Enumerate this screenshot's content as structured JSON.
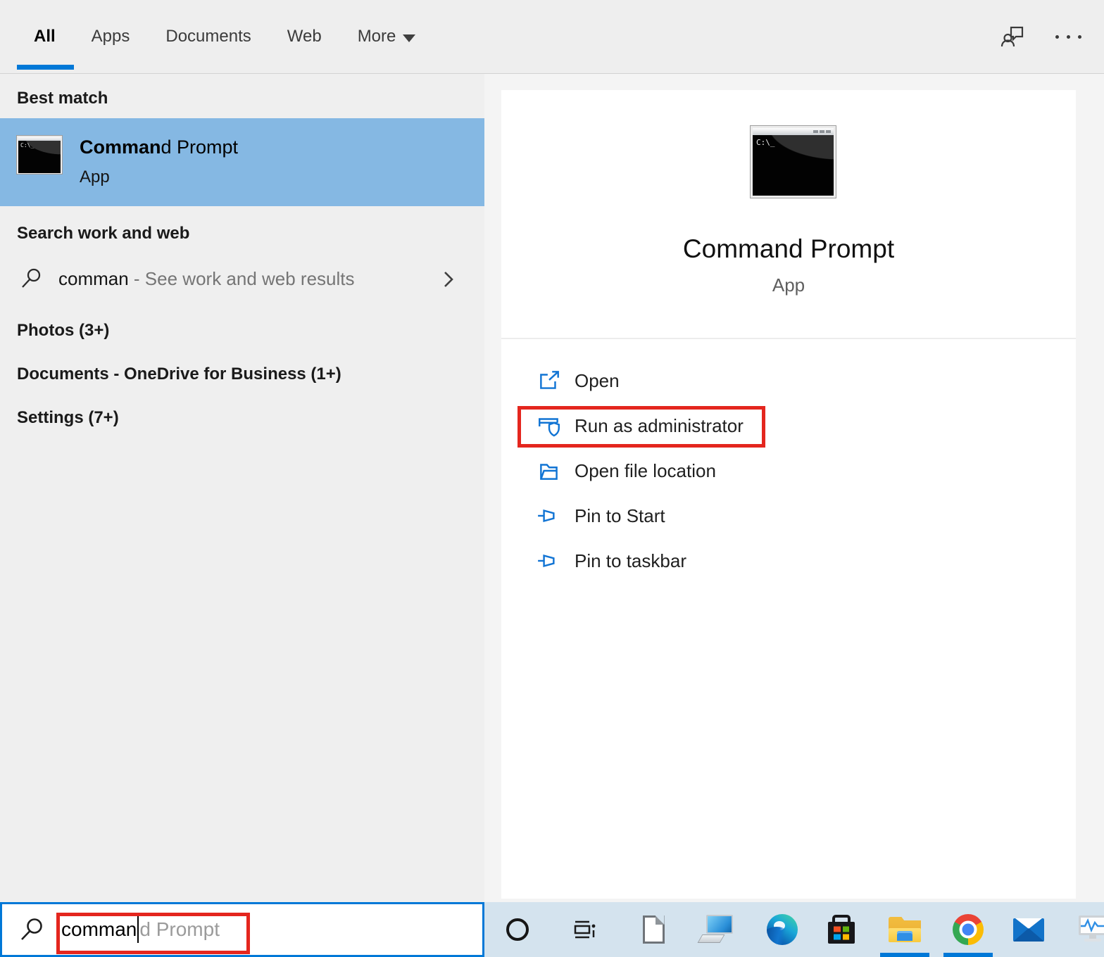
{
  "header": {
    "tabs": [
      {
        "label": "All",
        "active": true
      },
      {
        "label": "Apps",
        "active": false
      },
      {
        "label": "Documents",
        "active": false
      },
      {
        "label": "Web",
        "active": false
      },
      {
        "label": "More",
        "active": false,
        "dropdown": true
      }
    ]
  },
  "left_panel": {
    "best_match_label": "Best match",
    "best_match_item": {
      "title_match": "Comman",
      "title_rest": "d Prompt",
      "type": "App"
    },
    "search_web_label": "Search work and web",
    "web_row": {
      "query": "comman",
      "suffix": " - See work and web results"
    },
    "groups": [
      "Photos (3+)",
      "Documents - OneDrive for Business (1+)",
      "Settings (7+)"
    ]
  },
  "preview": {
    "title": "Command Prompt",
    "subtitle": "App",
    "cmd_text": "C:\\_",
    "actions": [
      {
        "label": "Open",
        "icon": "open-icon",
        "highlighted": false
      },
      {
        "label": "Run as administrator",
        "icon": "run-as-administrator-icon",
        "highlighted": true
      },
      {
        "label": "Open file location",
        "icon": "open-file-location-icon",
        "highlighted": false
      },
      {
        "label": "Pin to Start",
        "icon": "pin-icon",
        "highlighted": false
      },
      {
        "label": "Pin to taskbar",
        "icon": "pin-icon",
        "highlighted": false
      }
    ]
  },
  "search_box": {
    "typed": "comman",
    "suggestion": "d Prompt"
  },
  "taskbar": {
    "icons": [
      {
        "name": "cortana-icon",
        "running": false
      },
      {
        "name": "task-view-icon",
        "running": false
      },
      {
        "name": "libreoffice-icon",
        "running": false
      },
      {
        "name": "pc-icon",
        "running": false
      },
      {
        "name": "edge-icon",
        "running": false
      },
      {
        "name": "microsoft-store-icon",
        "running": false
      },
      {
        "name": "file-explorer-icon",
        "running": true
      },
      {
        "name": "chrome-icon",
        "running": true
      },
      {
        "name": "mail-icon",
        "running": false
      },
      {
        "name": "performance-monitor-icon",
        "running": false
      }
    ]
  },
  "colors": {
    "accent": "#0078d7",
    "highlight_blue": "#85b8e3",
    "taskbar_blue": "#d4e3ee",
    "annotation_red": "#e4261e",
    "action_icon_blue": "#1174d4"
  }
}
